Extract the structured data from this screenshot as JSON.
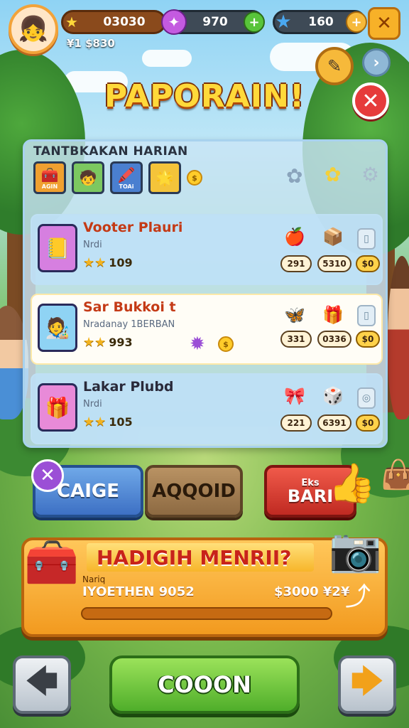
{
  "header": {
    "gold": "03030",
    "gems": "970",
    "stars": "160",
    "sub_coin": "¥1 $830",
    "avatar_emoji": "👧"
  },
  "title": "PAPORAIN!",
  "panel": {
    "title": "TANTBKAKAN HARIAN",
    "categories": [
      {
        "label": "AGIN",
        "icon": "🧰",
        "color": "#f0a030"
      },
      {
        "label": "",
        "icon": "🧒",
        "color": "#7cc860"
      },
      {
        "label": "TOAi",
        "icon": "🖍️",
        "color": "#4a7fd0"
      },
      {
        "label": "",
        "icon": "🌟",
        "color": "#f4c43a"
      }
    ],
    "items": [
      {
        "name": "Vooter Plauri",
        "desc": "Nrdi",
        "stars": "109",
        "icon": "📒",
        "icon_bg": "#d67fe0",
        "rewards": [
          "🍎",
          "📦"
        ],
        "pills": [
          "291",
          "5310",
          "$0"
        ]
      },
      {
        "name": "Sar Bukkoi t",
        "desc": "Nradanay 1BERBAN",
        "stars": "993",
        "icon": "🧑‍🎨",
        "icon_bg": "#8fd3f4",
        "rewards": [
          "🦋",
          "🎁"
        ],
        "pills": [
          "331",
          "0336",
          "$0"
        ]
      },
      {
        "name": "Lakar Plubd",
        "desc": "Nrdi",
        "stars": "105",
        "icon": "🎁",
        "icon_bg": "#e88ad8",
        "rewards": [
          "🎀",
          "🎲"
        ],
        "pills": [
          "221",
          "6391",
          "$0"
        ]
      }
    ]
  },
  "buttons": {
    "blue": "CAIGE",
    "brown": "AQQOID",
    "red_small": "Eks",
    "red": "BARI"
  },
  "offer": {
    "banner": "HADIGIH MENRII?",
    "small_label": "Nariq",
    "code": "IYOETHEN 9052",
    "price": "$3000 ¥2¥",
    "progress": 0.0
  },
  "bottom": {
    "go": "COOON",
    "left_arrow": "🡄",
    "right_arrow": "🡆"
  },
  "colors": {
    "accent_gold": "#ffd93a",
    "title_outline": "#7a2e06",
    "go_green": "#4fae2a",
    "close_red": "#e63b3b"
  }
}
